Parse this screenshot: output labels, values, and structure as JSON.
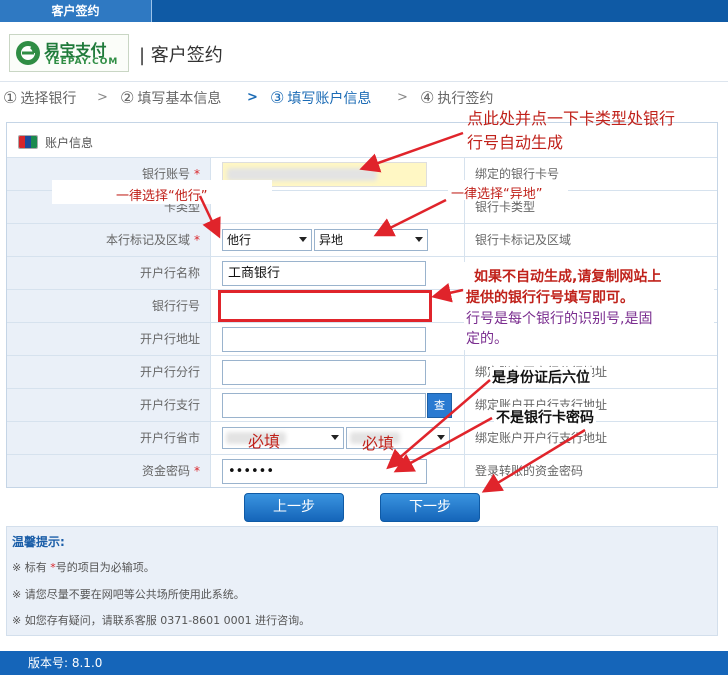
{
  "app": {
    "tab_title": "客户签约"
  },
  "header": {
    "logo_cn": "易宝支付",
    "logo_en": "YEEPAY.COM",
    "title": "| 客户签约"
  },
  "steps": [
    {
      "num": "①",
      "label": "选择银行"
    },
    {
      "num": "②",
      "label": "填写基本信息"
    },
    {
      "num": "③",
      "label": "填写账户信息"
    },
    {
      "num": "④",
      "label": "执行签约"
    }
  ],
  "panel": {
    "title": "账户信息"
  },
  "form": {
    "rows": [
      {
        "label": "银行账号",
        "required": true,
        "hint": "绑定的银行卡号"
      },
      {
        "label": "卡类型",
        "required": false,
        "hint": "银行卡类型"
      },
      {
        "label": "本行标记及区域",
        "required": true,
        "hint": "银行卡标记及区域"
      },
      {
        "label": "开户行名称",
        "required": false,
        "hint": ""
      },
      {
        "label": "银行行号",
        "required": false,
        "hint": ""
      },
      {
        "label": "开户行地址",
        "required": false,
        "hint": ""
      },
      {
        "label": "开户行分行",
        "required": false,
        "hint": "绑定账户开户行分行地址"
      },
      {
        "label": "开户行支行",
        "required": false,
        "hint": "绑定账户开户行支行地址"
      },
      {
        "label": "开户行省市",
        "required": false,
        "hint": "绑定账户开户行支行地址"
      },
      {
        "label": "资金密码",
        "required": true,
        "hint": "登录转账的资金密码"
      }
    ],
    "bank_mark_select": "他行",
    "region_select": "异地",
    "bank_name_value": "工商银行",
    "password_value": "••••••",
    "search_button": "查"
  },
  "buttons": {
    "prev": "上一步",
    "next": "下一步"
  },
  "tips": {
    "title": "温馨提示:",
    "item1_pre": "※ 标有",
    "item1_star": " *",
    "item1_post": "号的项目为必输项。",
    "item2": "※ 请您尽量不要在网吧等公共场所使用此系统。",
    "item3": "※ 如您存有疑问，请联系客服 0371-8601 0001 进行咨询。"
  },
  "footer": {
    "version": "版本号:  8.1.0"
  },
  "annotations": {
    "click_card_line1": "点此处并点一下卡类型处银行",
    "click_card_line2": "行号自动生成",
    "select_other_bank": "一律选择“他行”",
    "select_remote": "一律选择“异地”",
    "manual_line1": "如果不自动生成,请复制网站上",
    "manual_line2": "提供的银行行号填写即可。",
    "manual_line3": "行号是每个银行的识别号,是固",
    "manual_line4": "定的。",
    "required_fill_1": "必填",
    "required_fill_2": "必填",
    "id_last_six": "是身份证后六位",
    "not_card_password": "不是银行卡密码"
  }
}
